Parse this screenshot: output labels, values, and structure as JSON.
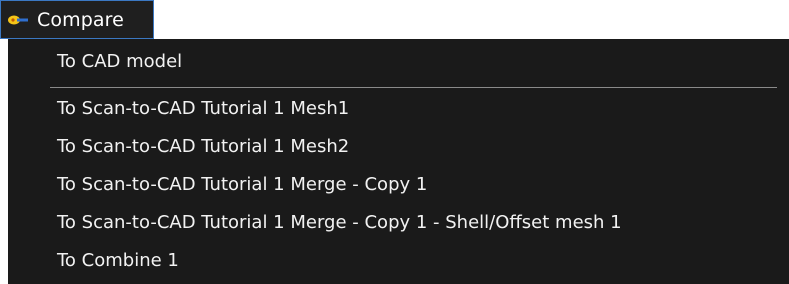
{
  "menu": {
    "title": "Compare",
    "icon": "compare-icon",
    "accent_color": "#3b78c2",
    "icon_color": "#f5c518"
  },
  "dropdown": {
    "items": [
      "To CAD model",
      "To Scan-to-CAD Tutorial 1 Mesh1",
      "To Scan-to-CAD Tutorial 1 Mesh2",
      "To Scan-to-CAD Tutorial 1 Merge - Copy 1",
      "To Scan-to-CAD Tutorial 1 Merge - Copy 1 - Shell/Offset mesh 1",
      "To Combine 1"
    ]
  }
}
